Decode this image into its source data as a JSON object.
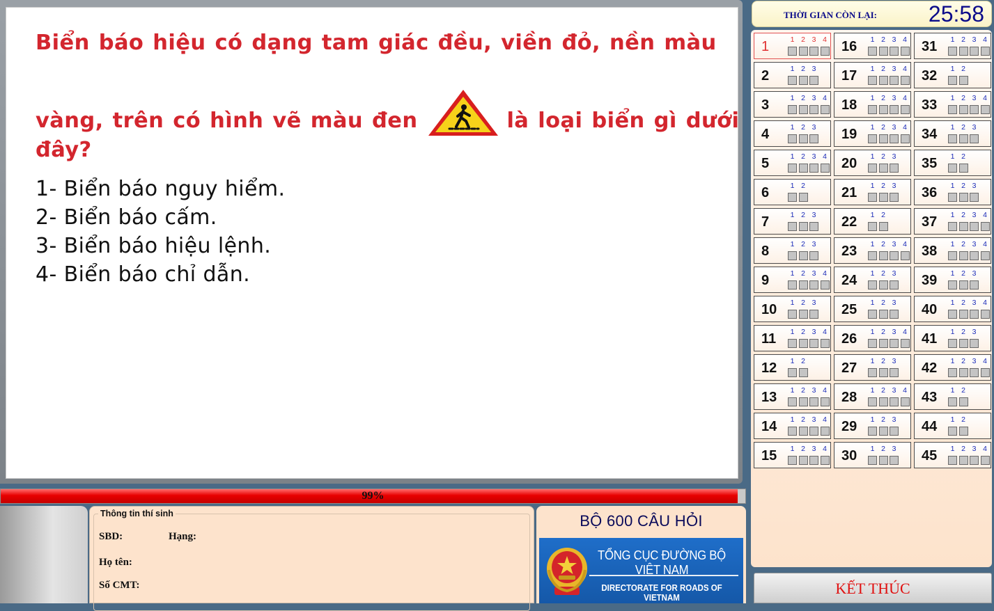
{
  "question": {
    "line1": "Biển báo hiệu có dạng tam giác đều, viền đỏ, nền màu",
    "line2_before": "vàng, trên có hình vẽ màu đen",
    "line2_after": "là loại biển gì dưới",
    "line3": "đây?",
    "sign_icon": "pedestrian-crossing-warning-sign",
    "answers": [
      "1- Biển báo nguy hiểm.",
      "2- Biển báo cấm.",
      "3- Biển báo hiệu lệnh.",
      "4- Biển báo chỉ dẫn."
    ]
  },
  "progress": {
    "label": "99%",
    "value": 0.99
  },
  "candidate_info": {
    "title": "Thông tin thí sinh",
    "sbd_label": "SBD:",
    "rank_label": "Hạng:",
    "name_label": "Họ tên:",
    "id_label": "Số CMT:"
  },
  "brand": {
    "title": "BỘ 600 CÂU HỎI",
    "org_vn": "TỔNG CỤC ĐƯỜNG BỘ VIỆT NAM",
    "org_en": "DIRECTORATE FOR ROADS OF VIETNAM"
  },
  "timer": {
    "label": "THỜI GIAN CÒN LẠI:",
    "value": "25:58"
  },
  "current_question": 1,
  "questions": [
    {
      "n": "1",
      "opts": 4
    },
    {
      "n": "2",
      "opts": 3
    },
    {
      "n": "3",
      "opts": 4
    },
    {
      "n": "4",
      "opts": 3
    },
    {
      "n": "5",
      "opts": 4
    },
    {
      "n": "6",
      "opts": 2
    },
    {
      "n": "7",
      "opts": 3
    },
    {
      "n": "8",
      "opts": 3
    },
    {
      "n": "9",
      "opts": 4
    },
    {
      "n": "10",
      "opts": 3
    },
    {
      "n": "11",
      "opts": 4
    },
    {
      "n": "12",
      "opts": 2
    },
    {
      "n": "13",
      "opts": 4
    },
    {
      "n": "14",
      "opts": 4
    },
    {
      "n": "15",
      "opts": 4
    },
    {
      "n": "16",
      "opts": 4
    },
    {
      "n": "17",
      "opts": 4
    },
    {
      "n": "18",
      "opts": 4
    },
    {
      "n": "19",
      "opts": 4
    },
    {
      "n": "20",
      "opts": 3
    },
    {
      "n": "21",
      "opts": 3
    },
    {
      "n": "22",
      "opts": 2
    },
    {
      "n": "23",
      "opts": 4
    },
    {
      "n": "24",
      "opts": 3
    },
    {
      "n": "25",
      "opts": 3
    },
    {
      "n": "26",
      "opts": 4
    },
    {
      "n": "27",
      "opts": 3
    },
    {
      "n": "28",
      "opts": 4
    },
    {
      "n": "29",
      "opts": 3
    },
    {
      "n": "30",
      "opts": 3
    },
    {
      "n": "31",
      "opts": 4
    },
    {
      "n": "32",
      "opts": 2
    },
    {
      "n": "33",
      "opts": 4
    },
    {
      "n": "34",
      "opts": 3
    },
    {
      "n": "35",
      "opts": 2
    },
    {
      "n": "36",
      "opts": 3
    },
    {
      "n": "37",
      "opts": 4
    },
    {
      "n": "38",
      "opts": 4
    },
    {
      "n": "39",
      "opts": 3
    },
    {
      "n": "40",
      "opts": 4
    },
    {
      "n": "41",
      "opts": 3
    },
    {
      "n": "42",
      "opts": 4
    },
    {
      "n": "43",
      "opts": 2
    },
    {
      "n": "44",
      "opts": 2
    },
    {
      "n": "45",
      "opts": 4
    }
  ],
  "finish_button": {
    "label": "KẾT THÚC"
  }
}
